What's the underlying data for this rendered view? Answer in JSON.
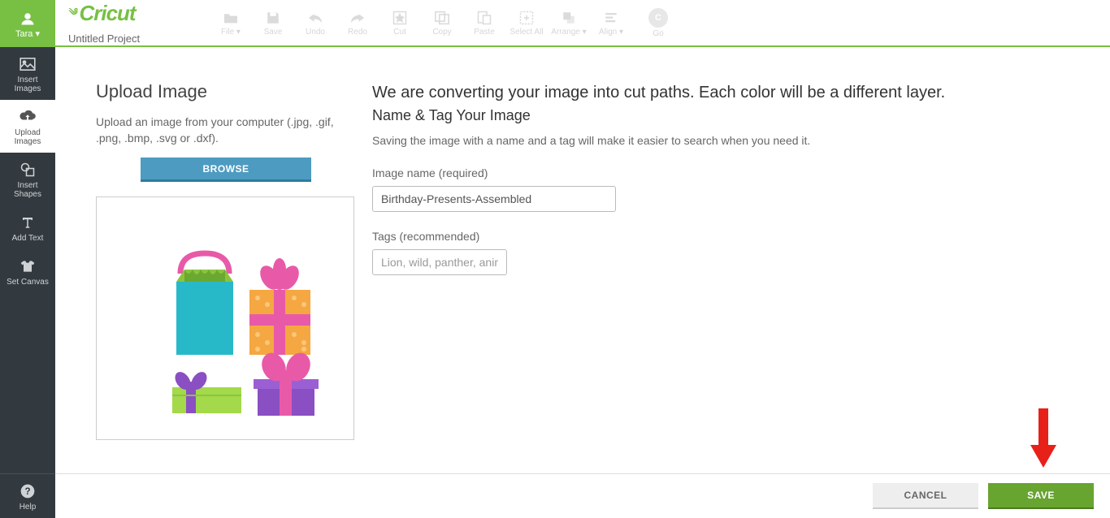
{
  "user": {
    "name": "Tara"
  },
  "brand": "Cricut",
  "project_title": "Untitled Project",
  "sidebar": {
    "insert_images": "Insert\nImages",
    "upload_images": "Upload\nImages",
    "insert_shapes": "Insert\nShapes",
    "add_text": "Add Text",
    "set_canvas": "Set Canvas",
    "help": "Help"
  },
  "toolbar": {
    "file": "File",
    "save": "Save",
    "undo": "Undo",
    "redo": "Redo",
    "cut": "Cut",
    "copy": "Copy",
    "paste": "Paste",
    "select_all": "Select All",
    "arrange": "Arrange",
    "align": "Align",
    "go": "Go",
    "go_badge": "C"
  },
  "upload": {
    "heading": "Upload Image",
    "instructions": "Upload an image from your computer (.jpg, .gif, .png, .bmp, .svg or .dxf).",
    "browse": "BROWSE"
  },
  "form": {
    "convert_heading": "We are converting your image into cut paths. Each color will be a different layer.",
    "name_tag_heading": "Name & Tag Your Image",
    "hint": "Saving the image with a name and a tag will make it easier to search when you need it.",
    "name_label": "Image name (required)",
    "name_value": "Birthday-Presents-Assembled",
    "tags_label": "Tags (recommended)",
    "tags_placeholder": "Lion, wild, panther, animals"
  },
  "buttons": {
    "cancel": "CANCEL",
    "save": "SAVE"
  }
}
